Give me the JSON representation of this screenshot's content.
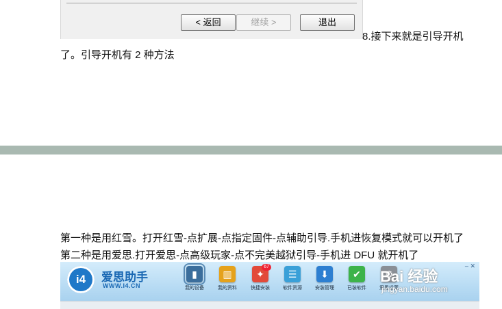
{
  "dialog": {
    "buttons": {
      "back": "< 返回",
      "next": "继续 >",
      "exit": "退出"
    }
  },
  "paragraphs": {
    "p1_end": "8.接下来就是引导开机",
    "p1_cont": "了。引导开机有 2 种方法",
    "p2": "第一种是用红雪。打开红雪-点扩展-点指定固件-点辅助引导.手机进恢复模式就可以开机了",
    "p3": "第二种是用爱思.打开爱思-点高级玩家-点不完美越狱引导-手机进 DFU 就开机了"
  },
  "app_banner": {
    "logo_text": "i4",
    "brand_name": "爱思助手",
    "brand_url": "WWW.I4.CN",
    "badge_count": "67",
    "tools": [
      {
        "label": "我的设备",
        "icon": "device-icon",
        "color": "#3b6e9c"
      },
      {
        "label": "我的资料",
        "icon": "chart-icon",
        "color": "#e5a21c"
      },
      {
        "label": "快捷安装",
        "icon": "install-icon",
        "color": "#e24a3a"
      },
      {
        "label": "软件资源",
        "icon": "resource-icon",
        "color": "#3aa0d8"
      },
      {
        "label": "安装管理",
        "icon": "download-icon",
        "color": "#2d7fd1"
      },
      {
        "label": "已装软件",
        "icon": "check-icon",
        "color": "#3db34a"
      },
      {
        "label": "爱思设置",
        "icon": "settings-icon",
        "color": "#8a8f96"
      }
    ]
  },
  "watermark": {
    "main": "Bai 经验",
    "sub": "jingyan.baidu.com"
  }
}
